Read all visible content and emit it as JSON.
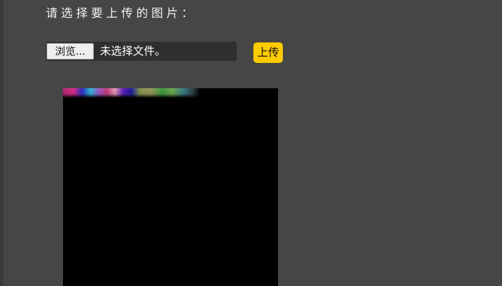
{
  "form": {
    "prompt": "请选择要上传的图片：",
    "browse_label": "浏览...",
    "file_status": "未选择文件。",
    "upload_label": "上传"
  },
  "colors": {
    "page_background": "#464646",
    "file_field_background": "#2f2f2f",
    "upload_button": "#ffcc00",
    "preview_background": "#000000"
  }
}
